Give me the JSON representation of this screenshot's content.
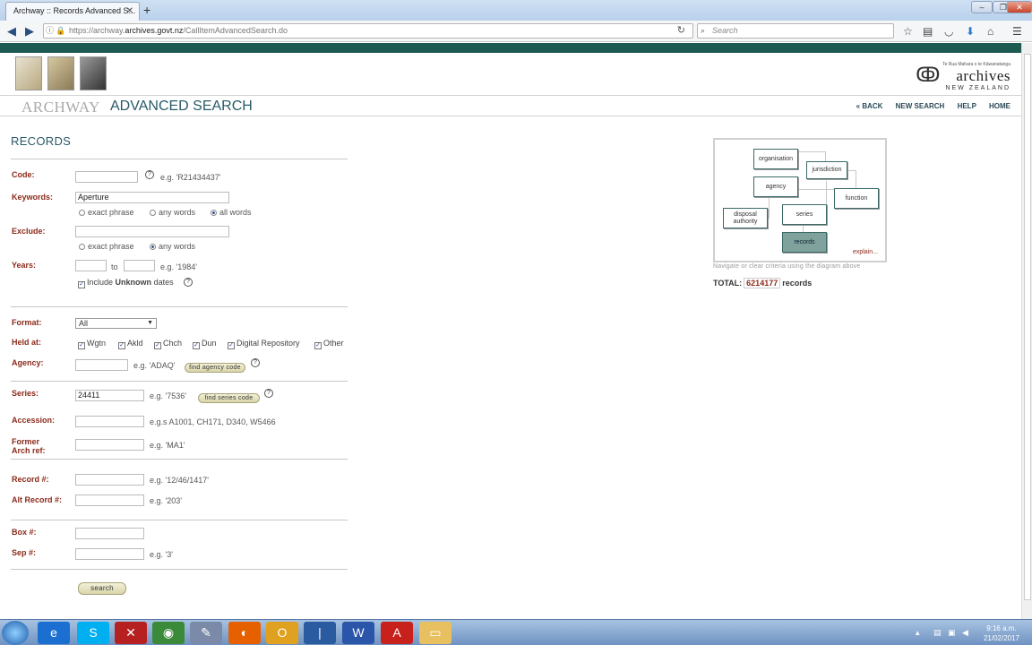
{
  "browser": {
    "tab_title": "Archway :: Records Advanced S...",
    "url_prefix": "https://archway.",
    "url_host": "archives.govt.nz",
    "url_path": "/CallItemAdvancedSearch.do",
    "search_placeholder": "Search"
  },
  "site": {
    "logo_maori": "Te Rua Mahara o te Kāwanatanga",
    "logo_name": "archives",
    "logo_sub": "NEW ZEALAND",
    "title_archway": "ARCHWAY",
    "title_adv": "ADVANCED SEARCH",
    "nav": [
      "« BACK",
      "NEW SEARCH",
      "HELP",
      "HOME"
    ]
  },
  "form": {
    "section": "RECORDS",
    "code": {
      "label": "Code:",
      "value": "",
      "eg": "e.g. 'R21434437'"
    },
    "keywords": {
      "label": "Keywords:",
      "value": "Aperture",
      "options": [
        "exact phrase",
        "any words",
        "all words"
      ],
      "selected": "all words"
    },
    "exclude": {
      "label": "Exclude:",
      "value": "",
      "options": [
        "exact phrase",
        "any words"
      ],
      "selected": "any words"
    },
    "years": {
      "label": "Years:",
      "from": "",
      "to_label": "to",
      "to": "",
      "eg": "e.g. '1984'",
      "include_prefix": "Include",
      "include_bold": "Unknown",
      "include_suffix": "dates"
    },
    "format": {
      "label": "Format:",
      "value": "All"
    },
    "held_at": {
      "label": "Held at:",
      "options": [
        "Wgtn",
        "Akld",
        "Chch",
        "Dun",
        "Digital Repository",
        "Other"
      ]
    },
    "agency": {
      "label": "Agency:",
      "value": "",
      "eg": "e.g. 'ADAQ'",
      "button": "find agency code"
    },
    "series": {
      "label": "Series:",
      "value": "24411",
      "eg": "e.g. '7536'",
      "button": "find series code"
    },
    "accession": {
      "label": "Accession:",
      "value": "",
      "eg": "e.g.s A1001, CH171, D340, W5466"
    },
    "former_arch": {
      "label_1": "Former",
      "label_2": "Arch ref:",
      "value": "",
      "eg": "e.g. 'MA1'"
    },
    "record": {
      "label": "Record #:",
      "value": "",
      "eg": "e.g. '12/46/1417'"
    },
    "alt_record": {
      "label": "Alt Record #:",
      "value": "",
      "eg": "e.g. '203'"
    },
    "box": {
      "label": "Box #:",
      "value": ""
    },
    "sep": {
      "label": "Sep #:",
      "value": "",
      "eg": "e.g. '3'"
    },
    "search_button": "search"
  },
  "diagram": {
    "boxes": {
      "organisation": "organisation",
      "jurisdiction": "jurisdiction",
      "agency": "agency",
      "function": "function",
      "disposal_1": "disposal",
      "disposal_2": "authority",
      "series": "series",
      "records": "records"
    },
    "explain": "explain...",
    "note": "Navigate or clear criteria using the diagram above"
  },
  "total": {
    "label": "TOTAL:",
    "count": "6214177",
    "suffix": "records"
  },
  "taskbar": {
    "time": "9:16 a.m.",
    "date": "21/02/2017"
  }
}
